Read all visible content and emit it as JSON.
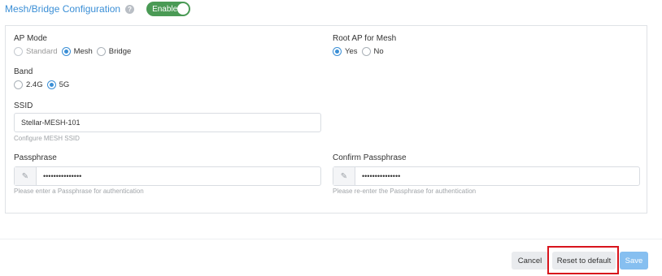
{
  "header": {
    "title": "Mesh/Bridge Configuration",
    "toggle_label": "Enabled"
  },
  "ap_mode": {
    "label": "AP Mode",
    "options": [
      "Standard",
      "Mesh",
      "Bridge"
    ],
    "selected": "Mesh"
  },
  "root_ap": {
    "label": "Root AP for Mesh",
    "options": [
      "Yes",
      "No"
    ],
    "selected": "Yes"
  },
  "band": {
    "label": "Band",
    "options": [
      "2.4G",
      "5G"
    ],
    "selected": "5G"
  },
  "ssid": {
    "label": "SSID",
    "value": "Stellar-MESH-101",
    "help": "Configure MESH SSID"
  },
  "passphrase": {
    "label": "Passphrase",
    "value": "•••••••••••••••",
    "help": "Please enter a Passphrase for authentication"
  },
  "confirm_passphrase": {
    "label": "Confirm Passphrase",
    "value": "•••••••••••••••",
    "help": "Please re-enter the Passphrase for authentication"
  },
  "footer": {
    "cancel_label": "Cancel",
    "reset_label": "Reset to default",
    "save_label": "Save"
  },
  "colors": {
    "accent": "#3b8fd6",
    "toggle_on": "#4a9a55",
    "highlight": "#d8141c"
  }
}
